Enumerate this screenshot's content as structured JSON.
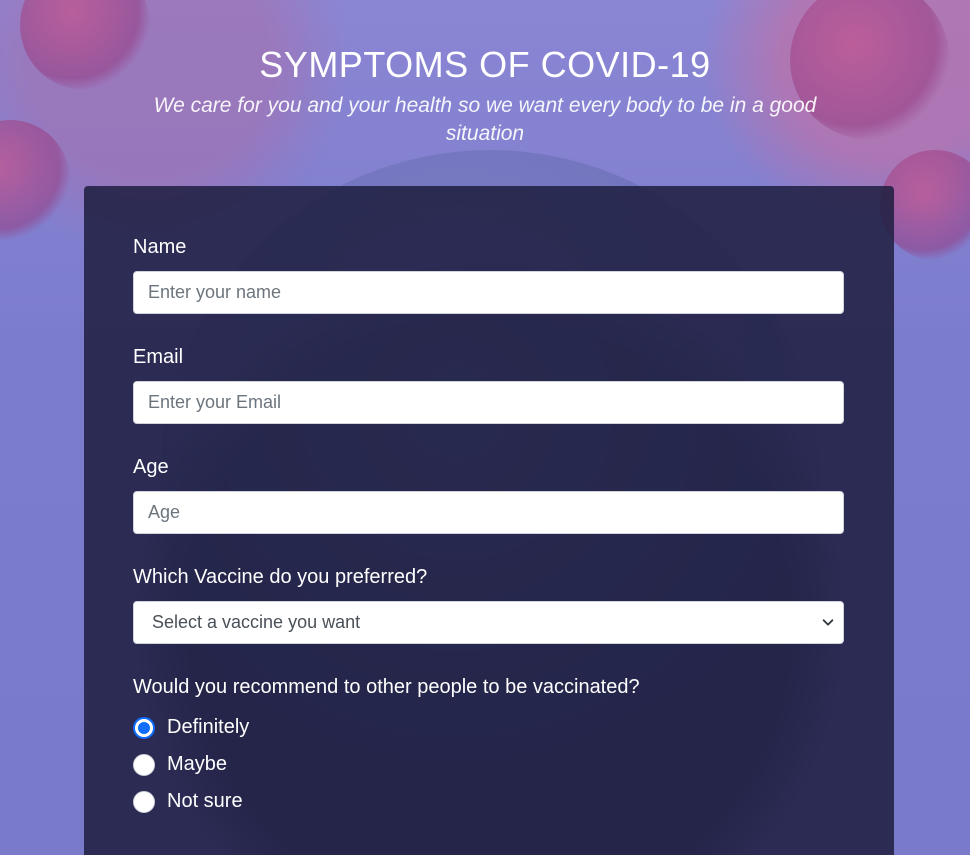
{
  "header": {
    "title": "SYMPTOMS OF COVID-19",
    "subtitle": "We care for you and your health so we want every body to be in a good situation"
  },
  "form": {
    "name": {
      "label": "Name",
      "placeholder": "Enter your name",
      "value": ""
    },
    "email": {
      "label": "Email",
      "placeholder": "Enter your Email",
      "value": ""
    },
    "age": {
      "label": "Age",
      "placeholder": "Age",
      "value": ""
    },
    "vaccine": {
      "label": "Which Vaccine do you preferred?",
      "selected": "Select a vaccine you want"
    },
    "recommend": {
      "label": "Would you recommend to other people to be vaccinated?",
      "options": [
        {
          "label": "Definitely",
          "checked": true
        },
        {
          "label": "Maybe",
          "checked": false
        },
        {
          "label": "Not sure",
          "checked": false
        }
      ]
    }
  },
  "colors": {
    "accent": "#0d6efd",
    "card_bg": "#1e1e40",
    "page_bg": "#7d7ccd"
  }
}
